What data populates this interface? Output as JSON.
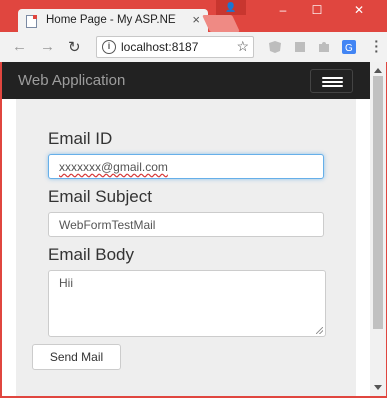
{
  "browser": {
    "tab_title": "Home Page - My ASP.NET",
    "tab_close": "×",
    "url": "localhost:8187",
    "window_controls": {
      "profile": "👤",
      "minimize": "–",
      "maximize": "☐",
      "close": "✕"
    },
    "toolbar_icons": [
      "back-icon",
      "forward-icon",
      "reload-icon",
      "info-icon",
      "star-icon",
      "extension-icons",
      "menu-icon"
    ]
  },
  "page": {
    "brand": "Web Application",
    "email_id": {
      "label": "Email ID",
      "value": "xxxxxxx@gmail.com"
    },
    "email_subject": {
      "label": "Email Subject",
      "value": "WebFormTestMail"
    },
    "email_body": {
      "label": "Email Body",
      "value": "Hii"
    },
    "send_button": "Send Mail"
  },
  "colors": {
    "frame": "#e0463f",
    "navbar": "#222222",
    "focus": "#66afe9"
  }
}
